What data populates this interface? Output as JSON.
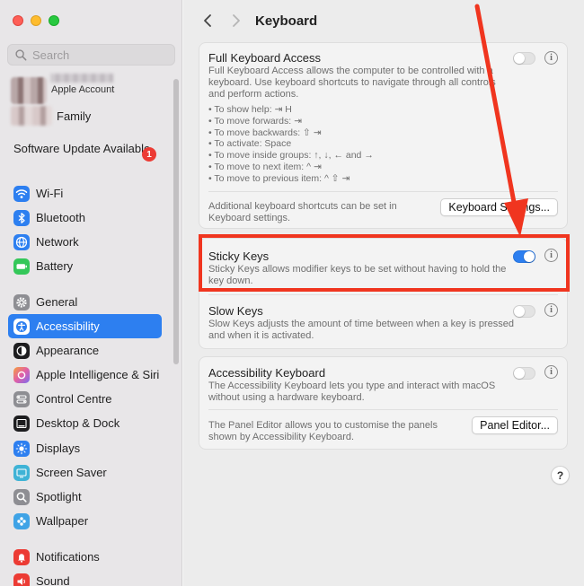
{
  "window": {
    "title": "Keyboard"
  },
  "sidebar": {
    "search_placeholder": "Search",
    "account_label": "Apple Account",
    "family_label": "Family",
    "software_update": "Software Update Available",
    "software_update_badge": "1",
    "items": [
      {
        "label": "Wi-Fi",
        "icon": "wifi-icon",
        "color": "#2d7ff0"
      },
      {
        "label": "Bluetooth",
        "icon": "bluetooth-icon",
        "color": "#2d7ff0"
      },
      {
        "label": "Network",
        "icon": "globe-icon",
        "color": "#2d7ff0"
      },
      {
        "label": "Battery",
        "icon": "battery-icon",
        "color": "#34c759"
      },
      {
        "label": "General",
        "icon": "gear-icon",
        "color": "#8e8e93"
      },
      {
        "label": "Accessibility",
        "icon": "accessibility-icon",
        "color": "#2d7ff0",
        "active": true
      },
      {
        "label": "Appearance",
        "icon": "appearance-icon",
        "color": "#1d1d1f"
      },
      {
        "label": "Apple Intelligence & Siri",
        "icon": "siri-icon",
        "color": "#e05fa7"
      },
      {
        "label": "Control Centre",
        "icon": "control-centre-icon",
        "color": "#8e8e93"
      },
      {
        "label": "Desktop & Dock",
        "icon": "dock-icon",
        "color": "#1d1d1f"
      },
      {
        "label": "Displays",
        "icon": "sun-icon",
        "color": "#2d7ff0"
      },
      {
        "label": "Screen Saver",
        "icon": "screen-saver-icon",
        "color": "#3fb3d6"
      },
      {
        "label": "Spotlight",
        "icon": "magnifier-icon",
        "color": "#8e8e93"
      },
      {
        "label": "Wallpaper",
        "icon": "flower-icon",
        "color": "#3fa3e6"
      },
      {
        "label": "Notifications",
        "icon": "bell-icon",
        "color": "#ec3b34"
      },
      {
        "label": "Sound",
        "icon": "speaker-icon",
        "color": "#ec3b34"
      }
    ]
  },
  "main": {
    "full_keyboard_access": {
      "title": "Full Keyboard Access",
      "description": "Full Keyboard Access allows the computer to be controlled with a keyboard. Use keyboard shortcuts to navigate through all controls and perform actions.",
      "enabled": false,
      "bullets": [
        "• To show help: ⇥ H",
        "• To move forwards: ⇥",
        "• To move backwards: ⇧ ⇥",
        "• To activate: Space",
        "• To move inside groups: ↑, ↓, ← and →",
        "• To move to next item: ^ ⇥",
        "• To move to previous item: ^ ⇧ ⇥"
      ],
      "footer": "Additional keyboard shortcuts can be set in Keyboard settings.",
      "button": "Keyboard Settings..."
    },
    "sticky_keys": {
      "title": "Sticky Keys",
      "description": "Sticky Keys allows modifier keys to be set without having to hold the key down.",
      "enabled": true
    },
    "slow_keys": {
      "title": "Slow Keys",
      "description": "Slow Keys adjusts the amount of time between when a key is pressed and when it is activated.",
      "enabled": false
    },
    "accessibility_keyboard": {
      "title": "Accessibility Keyboard",
      "description": "The Accessibility Keyboard lets you type and interact with macOS without using a hardware keyboard.",
      "enabled": false,
      "footer": "The Panel Editor allows you to customise the panels shown by Accessibility Keyboard.",
      "button": "Panel Editor..."
    },
    "info_glyph": "i",
    "help_glyph": "?"
  },
  "annotation": {
    "color": "#f0351f"
  }
}
